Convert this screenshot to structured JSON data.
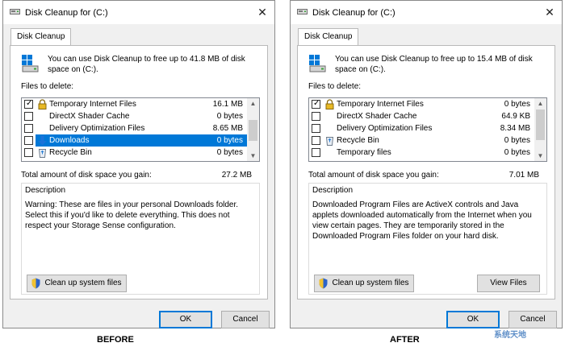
{
  "windows": [
    {
      "title": "Disk Cleanup for  (C:)",
      "tab": "Disk Cleanup",
      "intro": "You can use Disk Cleanup to free up to 41.8 MB of disk space on  (C:).",
      "files_label": "Files to delete:",
      "files": [
        {
          "name": "Temporary Internet Files",
          "size": "16.1 MB",
          "checked": true,
          "icon": "lock-icon"
        },
        {
          "name": "DirectX Shader Cache",
          "size": "0 bytes",
          "checked": false,
          "icon": "none"
        },
        {
          "name": "Delivery Optimization Files",
          "size": "8.65 MB",
          "checked": false,
          "icon": "none"
        },
        {
          "name": "Downloads",
          "size": "0 bytes",
          "checked": false,
          "icon": "download-arrow-icon",
          "selected": true
        },
        {
          "name": "Recycle Bin",
          "size": "0 bytes",
          "checked": false,
          "icon": "recycle-bin-icon"
        }
      ],
      "total_label": "Total amount of disk space you gain:",
      "total_value": "27.2 MB",
      "description_label": "Description",
      "description": "Warning: These are files in your personal Downloads folder. Select this if you'd like to delete everything. This does not respect your Storage Sense configuration.",
      "cleanup_button": "Clean up system files",
      "view_files_button": null,
      "ok_button": "OK",
      "cancel_button": "Cancel",
      "caption": "BEFORE"
    },
    {
      "title": "Disk Cleanup for  (C:)",
      "tab": "Disk Cleanup",
      "intro": "You can use Disk Cleanup to free up to 15.4 MB of disk space on  (C:).",
      "files_label": "Files to delete:",
      "files": [
        {
          "name": "Temporary Internet Files",
          "size": "0 bytes",
          "checked": true,
          "icon": "lock-icon"
        },
        {
          "name": "DirectX Shader Cache",
          "size": "64.9 KB",
          "checked": false,
          "icon": "none"
        },
        {
          "name": "Delivery Optimization Files",
          "size": "8.34 MB",
          "checked": false,
          "icon": "none"
        },
        {
          "name": "Recycle Bin",
          "size": "0 bytes",
          "checked": false,
          "icon": "recycle-bin-icon"
        },
        {
          "name": "Temporary files",
          "size": "0 bytes",
          "checked": false,
          "icon": "none"
        }
      ],
      "total_label": "Total amount of disk space you gain:",
      "total_value": "7.01 MB",
      "description_label": "Description",
      "description": "Downloaded Program Files are ActiveX controls and Java applets downloaded automatically from the Internet when you view certain pages. They are temporarily stored in the Downloaded Program Files folder on your hard disk.",
      "cleanup_button": "Clean up system files",
      "view_files_button": "View Files",
      "ok_button": "OK",
      "cancel_button": "Cancel",
      "caption": "AFTER"
    }
  ],
  "watermark": "系统天地",
  "colors": {
    "selection": "#0078d7",
    "default_button_border": "#0078d7"
  }
}
